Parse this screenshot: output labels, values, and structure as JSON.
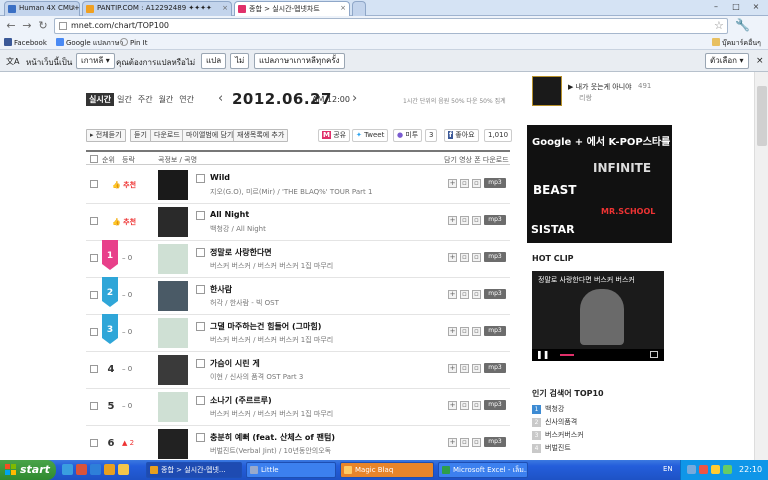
{
  "browser": {
    "tabs": [
      {
        "label": "Human 4X CMU+",
        "color": "#3a6fc4",
        "active": false
      },
      {
        "label": "PANTIP.COM : A12292489 ✦✦✦✦",
        "color": "#f0a020",
        "active": false
      },
      {
        "label": "종합 > 실시간-멥넷차트",
        "color": "#e0306a",
        "active": true
      }
    ],
    "url": "mnet.com/chart/TOP100",
    "bookmarks": [
      "Facebook",
      "Google แปลภาษา",
      "Pin It"
    ],
    "other_bookmarks": "บุ๊คมาร์คอื่นๆ"
  },
  "translate_bar": {
    "prefix": "หน้าเว็บนี้เป็น",
    "language": "เกาหลี",
    "question": "คุณต้องการแปลหรือไม่",
    "translate": "แปล",
    "no": "ไม่",
    "never": "แปลภาษาเกาหลีทุกครั้ง",
    "options": "ตัวเลือก"
  },
  "chart": {
    "period_tabs": [
      "실시간",
      "일간",
      "주간",
      "월간",
      "연간"
    ],
    "date": "2012.06.27",
    "time": "AM 12:00",
    "note": "1시간 단위의 음원 50% 다운 50% 집계",
    "actions": [
      "전체듣기",
      "듣기",
      "다운로드",
      "마이앨범에 담기",
      "재생목록에 추가"
    ],
    "shares": {
      "mnet": "공유",
      "tweet": "Tweet",
      "me2day": "미투",
      "me2_count": "3",
      "fb": "좋아요",
      "fb_count": "1,010"
    },
    "headers": {
      "rank": "순위",
      "change": "등락",
      "song": "곡정보 / 곡명",
      "actions": "담기 영상 폰 다운로드"
    },
    "rows": [
      {
        "rank": "",
        "change": "추천",
        "type": "new",
        "title": "Wild",
        "meta": "지오(G.O), 미르(Mir)  /  'THE BLAQ%' TOUR Part 1",
        "thumb": "#1a1a1a"
      },
      {
        "rank": "",
        "change": "추천",
        "type": "new",
        "title": "All Night",
        "meta": "백청강  /  All Night",
        "thumb": "#2a2a2a"
      },
      {
        "rank": "1",
        "change": "0",
        "type": "badge",
        "badge_color": "#e8408a",
        "title": "정말로 사랑한다면",
        "meta": "버스커 버스커  /  버스커 버스커 1집 마무리",
        "thumb": "#cfe0d4"
      },
      {
        "rank": "2",
        "change": "0",
        "type": "badge",
        "badge_color": "#2fa6d8",
        "title": "한사람",
        "meta": "허각  /  한사람 - 빅 OST",
        "thumb": "#4a5a66"
      },
      {
        "rank": "3",
        "change": "0",
        "type": "badge",
        "badge_color": "#2fa6d8",
        "title": "그댈 마주하는건 힘들어 (그마힘)",
        "meta": "버스커 버스커  /  버스커 버스커 1집 마무리",
        "thumb": "#cfe0d4"
      },
      {
        "rank": "4",
        "change": "0",
        "type": "plain",
        "title": "가슴이 시린 게",
        "meta": "이현  /  신사의 품격 OST Part 3",
        "thumb": "#3a3a3a"
      },
      {
        "rank": "5",
        "change": "0",
        "type": "plain",
        "title": "소나기 (주르르루)",
        "meta": "버스커 버스커  /  버스커 버스커 1집 마무리",
        "thumb": "#cfe0d4"
      },
      {
        "rank": "6",
        "change": "2",
        "type": "up",
        "title": "충분히 예뻐 (feat. 산체스 of 팬텀)",
        "meta": "버벌진트(Verbal Jint)  /  10년동안의오독",
        "thumb": "#222"
      }
    ]
  },
  "sidebar": {
    "now_song": "내가 웃는게 아니야",
    "now_artist": "리쌍",
    "now_count": "491",
    "ad_text": "Google + 에서 K-POP스타를 만나세요",
    "ad_names": [
      "BEAST",
      "INFINITE",
      "SISTAR",
      "MR.SCHOOL"
    ],
    "hot_clip": "HOT CLIP",
    "clip_caption": "정말로 사랑한다면 버스커 버스커",
    "keywords_title": "인기 검색어 TOP10",
    "keywords": [
      "백청강",
      "신사의품격",
      "버스커버스커",
      "버벌진트"
    ]
  },
  "taskbar": {
    "start": "start",
    "tasks": [
      "종합 > 실시간-멥넷...",
      "Little",
      "Magic Blaq",
      "Microsoft Excel - เล็ม..."
    ],
    "lang": "EN",
    "clock": "22:10"
  }
}
